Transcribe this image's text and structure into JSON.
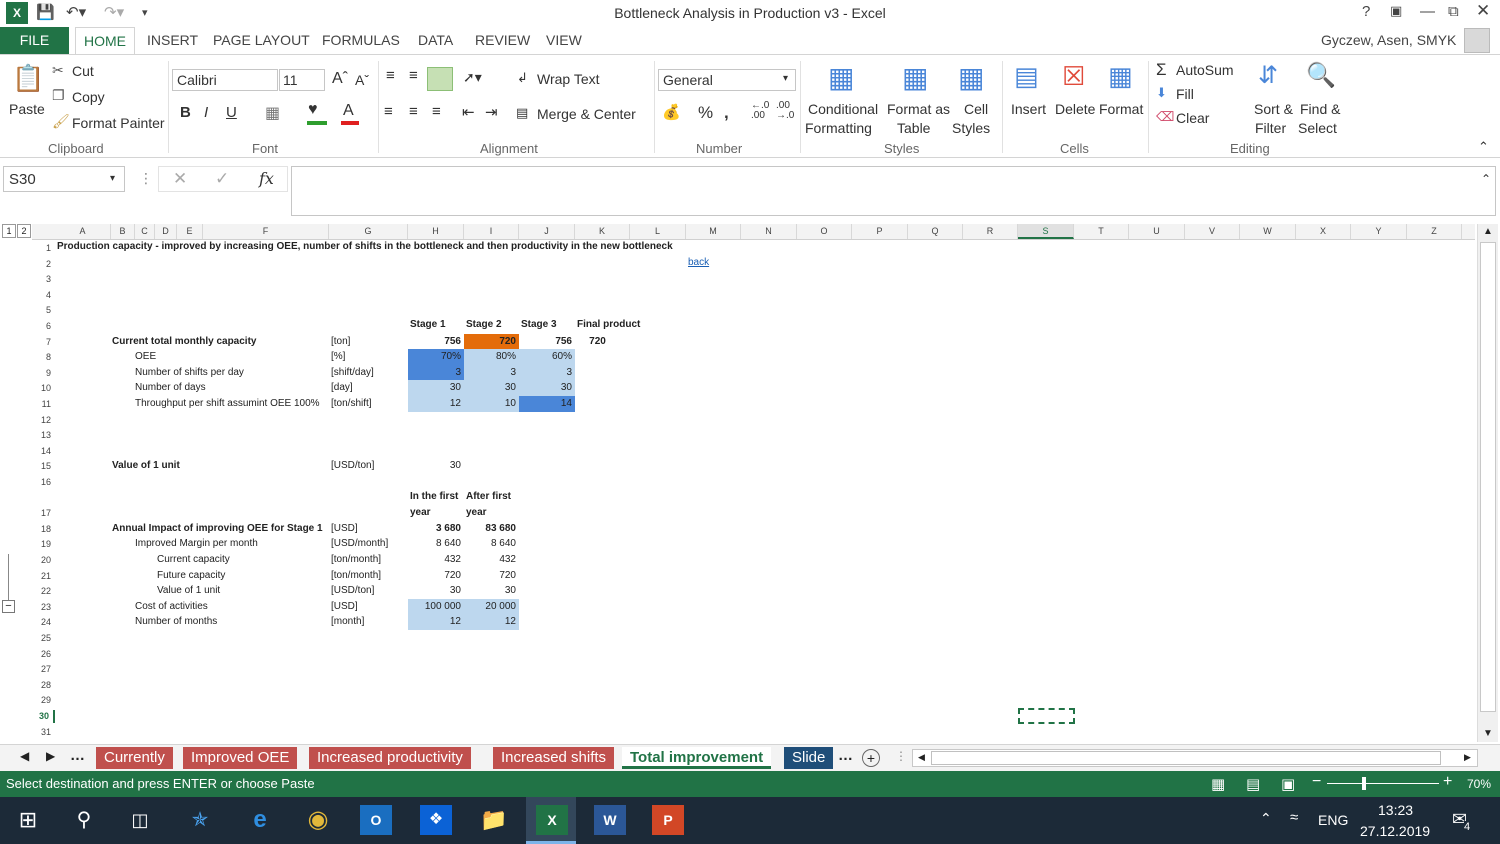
{
  "window": {
    "title": "Bottleneck Analysis in Production v3 - Excel",
    "user": "Gyczew, Asen, SMYK"
  },
  "tabs": {
    "file": "FILE",
    "items": [
      "HOME",
      "INSERT",
      "PAGE LAYOUT",
      "FORMULAS",
      "DATA",
      "REVIEW",
      "VIEW"
    ]
  },
  "ribbon": {
    "clipboard": {
      "paste": "Paste",
      "cut": "Cut",
      "copy": "Copy",
      "format_painter": "Format Painter",
      "group": "Clipboard"
    },
    "font": {
      "name": "Calibri",
      "size": "11",
      "group": "Font"
    },
    "alignment": {
      "wrap": "Wrap Text",
      "merge": "Merge & Center",
      "group": "Alignment"
    },
    "number": {
      "format": "General",
      "group": "Number"
    },
    "styles": {
      "cond1": "Conditional",
      "cond2": "Formatting",
      "fmt1": "Format as",
      "fmt2": "Table",
      "cell1": "Cell",
      "cell2": "Styles",
      "group": "Styles"
    },
    "cells": {
      "insert": "Insert",
      "delete": "Delete",
      "format": "Format",
      "group": "Cells"
    },
    "editing": {
      "autosum": "AutoSum",
      "fill": "Fill",
      "clear": "Clear",
      "sort1": "Sort &",
      "sort2": "Filter",
      "find1": "Find &",
      "find2": "Select",
      "group": "Editing"
    }
  },
  "formula_bar": {
    "name_box": "S30",
    "fx": "fx"
  },
  "columns": [
    "A",
    "B",
    "C",
    "D",
    "E",
    "F",
    "G",
    "H",
    "I",
    "J",
    "K",
    "L",
    "M",
    "N",
    "O",
    "P",
    "Q",
    "R",
    "S",
    "T",
    "U",
    "V",
    "W",
    "X",
    "Y",
    "Z"
  ],
  "rows": [
    "1",
    "2",
    "3",
    "4",
    "5",
    "6",
    "7",
    "8",
    "9",
    "10",
    "11",
    "12",
    "13",
    "14",
    "15",
    "16",
    "17",
    "18",
    "19",
    "20",
    "21",
    "22",
    "23",
    "24",
    "25",
    "26",
    "27",
    "28",
    "29",
    "30",
    "31"
  ],
  "cells": {
    "r1": "Production capacity - improved by increasing OEE, number of shifts in the bottleneck and then productivity in the new bottleneck",
    "r2": "back",
    "h_stage1": "Stage 1",
    "h_stage2": "Stage 2",
    "h_stage3": "Stage 3",
    "h_final": "Final product",
    "r7": {
      "label": "Current total monthly capacity",
      "unit": "[ton]",
      "h": "756",
      "i": "720",
      "j": "756",
      "k": "720"
    },
    "r8": {
      "label": "OEE",
      "unit": "[%]",
      "h": "70%",
      "i": "80%",
      "j": "60%"
    },
    "r9": {
      "label": "Number of shifts per day",
      "unit": "[shift/day]",
      "h": "3",
      "i": "3",
      "j": "3"
    },
    "r10": {
      "label": "Number of days",
      "unit": "[day]",
      "h": "30",
      "i": "30",
      "j": "30"
    },
    "r11": {
      "label": "Throughput per shift assumint OEE 100%",
      "unit": "[ton/shift]",
      "h": "12",
      "i": "10",
      "j": "14"
    },
    "r15": {
      "label": "Value of 1 unit",
      "unit": "[USD/ton]",
      "h": "30"
    },
    "h_first1": "In the first",
    "h_first2": "year",
    "h_after1": "After first",
    "h_after2": "year",
    "r18": {
      "label": "Annual Impact of improving OEE for Stage 1",
      "unit": "[USD]",
      "h": "3 680",
      "i": "83 680"
    },
    "r19": {
      "label": "Improved Margin per month",
      "unit": "[USD/month]",
      "h": "8 640",
      "i": "8 640"
    },
    "r20": {
      "label": "Current capacity",
      "unit": "[ton/month]",
      "h": "432",
      "i": "432"
    },
    "r21": {
      "label": "Future capacity",
      "unit": "[ton/month]",
      "h": "720",
      "i": "720"
    },
    "r22": {
      "label": "Value of 1 unit",
      "unit": "[USD/ton]",
      "h": "30",
      "i": "30"
    },
    "r23": {
      "label": "Cost of activities",
      "unit": "[USD]",
      "h": "100 000",
      "i": "20 000"
    },
    "r24": {
      "label": "Number of months",
      "unit": "[month]",
      "h": "12",
      "i": "12"
    }
  },
  "sheets": [
    "Currently",
    "Improved OEE",
    "Increased productivity",
    "Increased shifts",
    "Total improvement",
    "Slide"
  ],
  "status": {
    "message": "Select destination and press ENTER or choose Paste",
    "zoom": "70%"
  },
  "taskbar": {
    "lang": "ENG",
    "time": "13:23",
    "date": "27.12.2019",
    "notif": "4"
  },
  "colors": {
    "excel_green": "#217346",
    "blue_dark": "#4a86d8",
    "blue_light": "#bdd7ee",
    "orange": "#e46c0a",
    "tab_red": "#c0504d"
  }
}
